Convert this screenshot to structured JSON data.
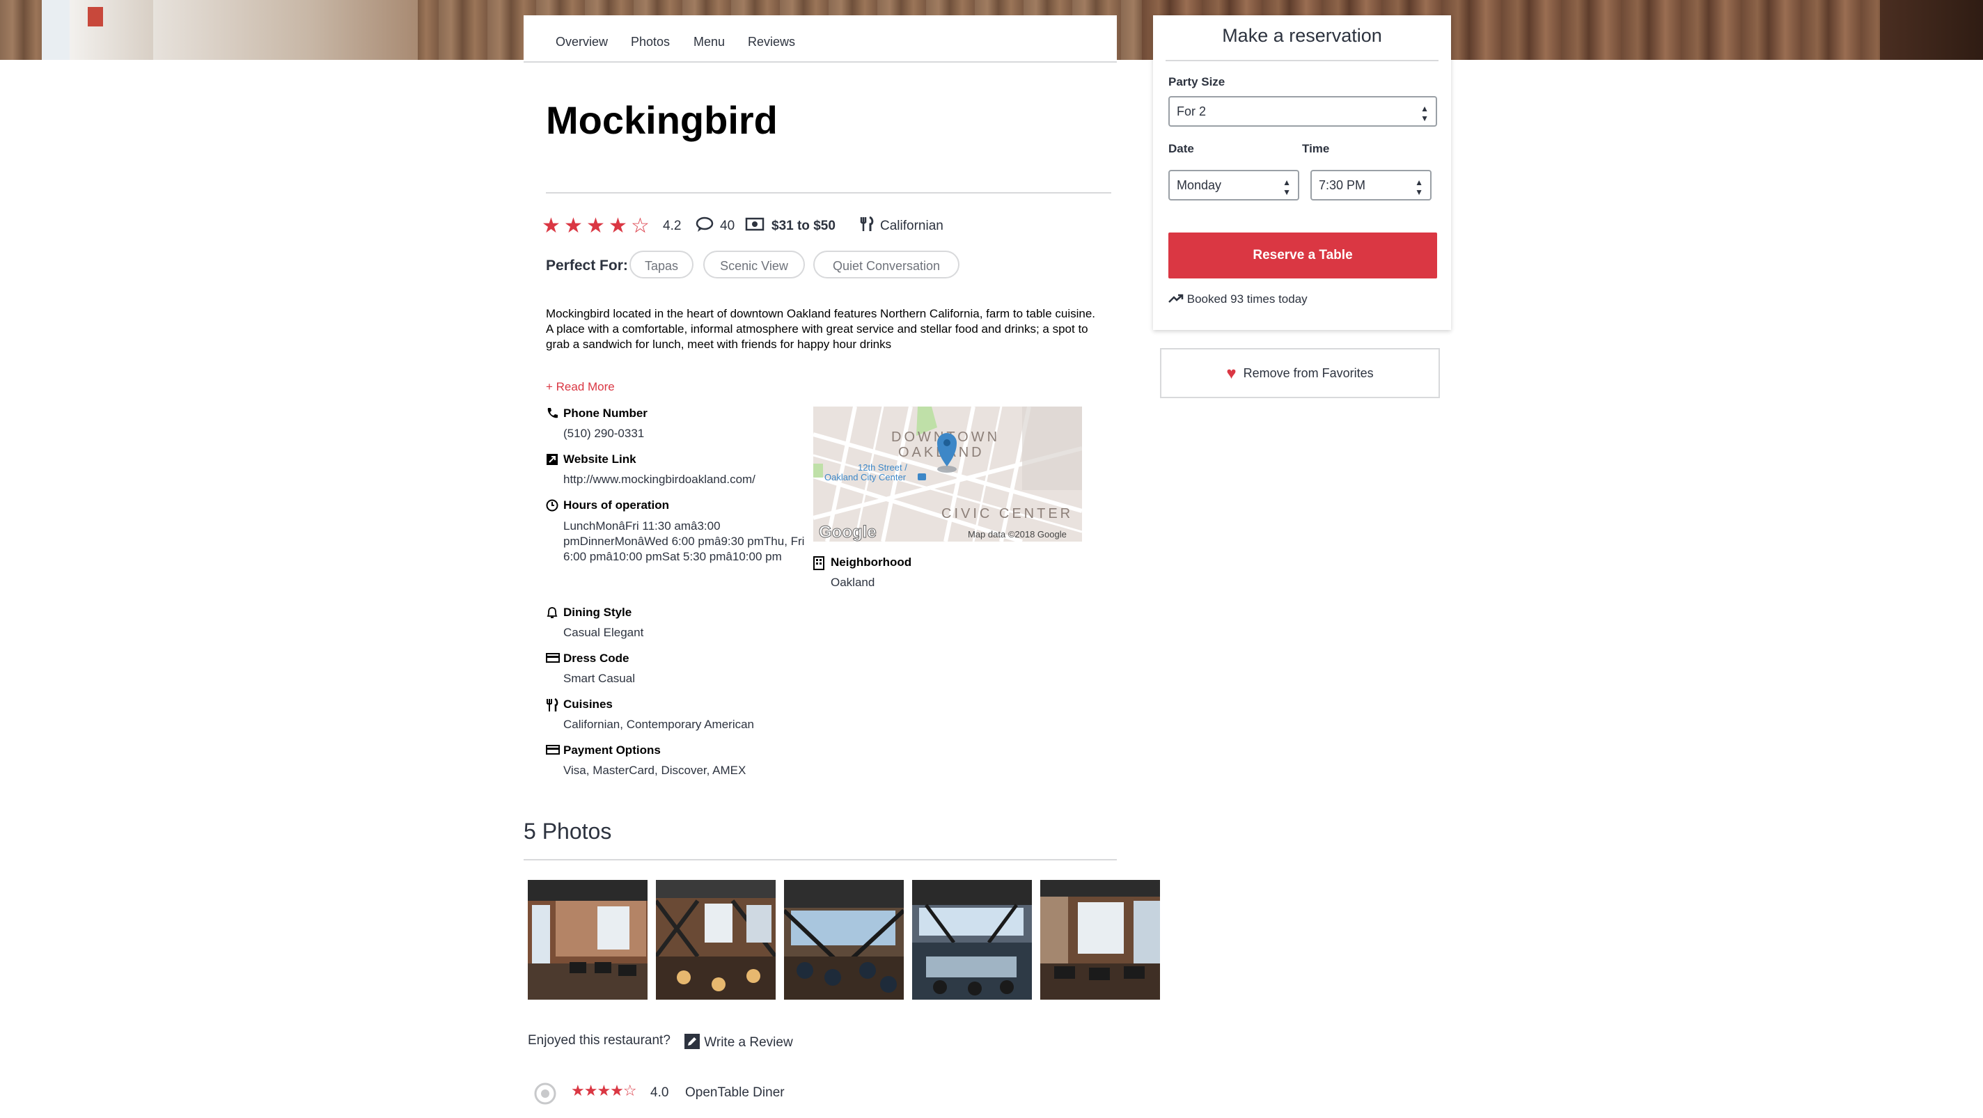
{
  "tabs": [
    "Overview",
    "Photos",
    "Menu",
    "Reviews"
  ],
  "restaurant": {
    "name": "Mockingbird",
    "rating": "4.2",
    "rating_value": 4.2,
    "reviews_count": "40",
    "price": "$31 to $50",
    "cuisine": "Californian",
    "perfect_for_label": "Perfect For:",
    "tags": [
      "Tapas",
      "Scenic View",
      "Quiet Conversation"
    ],
    "description": "Mockingbird located in the heart of downtown Oakland features Northern California, farm to table cuisine. A place with a comfortable, informal atmosphere with great service and stellar food and drinks; a spot to grab a sandwich for lunch, meet with friends for happy hour drinks",
    "read_more": "+ Read More"
  },
  "details": {
    "phone": {
      "label": "Phone Number",
      "value": "(510) 290-0331",
      "icon": "phone-icon"
    },
    "website": {
      "label": "Website Link",
      "value": "http://www.mockingbirdoakland.com/",
      "icon": "external-link-icon"
    },
    "hours": {
      "label": "Hours of operation",
      "value": "LunchMonâFri 11:30 amâ3:00 pmDinnerMonâWed 6:00 pmâ9:30 pmThu, Fri 6:00 pmâ10:00 pmSat 5:30 pmâ10:00 pm",
      "icon": "clock-icon"
    },
    "dining_style": {
      "label": "Dining Style",
      "value": "Casual Elegant",
      "icon": "bell-icon"
    },
    "dress_code": {
      "label": "Dress Code",
      "value": "Smart Casual",
      "icon": "card-icon"
    },
    "cuisines": {
      "label": "Cuisines",
      "value": "Californian, Contemporary American",
      "icon": "utensils-icon"
    },
    "payment": {
      "label": "Payment Options",
      "value": "Visa, MasterCard, Discover, AMEX",
      "icon": "card-icon"
    },
    "neighborhood": {
      "label": "Neighborhood",
      "value": "Oakland",
      "icon": "building-icon"
    }
  },
  "map": {
    "district_label": "DOWNTOWN OAKLAND",
    "district_line1": "DOWNTOWN",
    "district_line2": "OAKLAND",
    "station_line1": "12th Street /",
    "station_line2": "Oakland City Center",
    "civic_label": "CIVIC CENTER",
    "logo": "Google",
    "attribution": "Map data ©2018 Google"
  },
  "photos": {
    "title": "5 Photos",
    "count": 5
  },
  "review_prompt": {
    "enjoy": "Enjoyed this restaurant?",
    "write": "Write a Review"
  },
  "first_review": {
    "rating": "4.0",
    "rating_value": 4.0,
    "author": "OpenTable Diner"
  },
  "reservation": {
    "title": "Make a reservation",
    "party_label": "Party Size",
    "party_value": "For 2",
    "date_label": "Date",
    "date_value": "Monday",
    "time_label": "Time",
    "time_value": "7:30 PM",
    "reserve_button": "Reserve a Table",
    "booked": "Booked 93 times today"
  },
  "favorites_button": "Remove from Favorites",
  "colors": {
    "accent": "#da3743",
    "text": "#2d333f",
    "border": "#d8d9db"
  }
}
